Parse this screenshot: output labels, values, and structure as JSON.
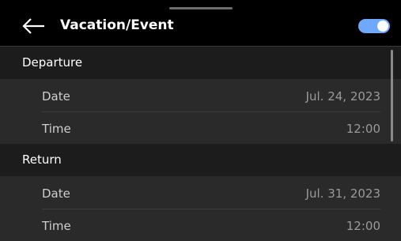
{
  "header": {
    "title": "Vacation/Event",
    "back_icon": "arrow-left-icon",
    "toggle_on": true,
    "toggle_color": "#6ea8ff"
  },
  "sections": [
    {
      "title": "Departure",
      "rows": [
        {
          "label": "Date",
          "value": "Jul. 24, 2023"
        },
        {
          "label": "Time",
          "value": "12:00"
        }
      ]
    },
    {
      "title": "Return",
      "rows": [
        {
          "label": "Date",
          "value": "Jul. 31, 2023"
        },
        {
          "label": "Time",
          "value": "12:00"
        }
      ]
    }
  ]
}
